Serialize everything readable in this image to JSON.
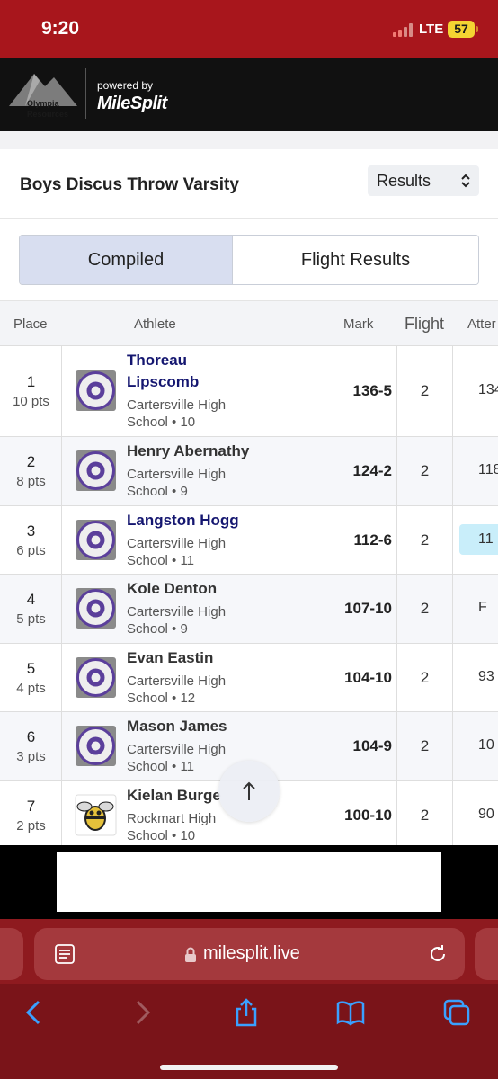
{
  "status_bar": {
    "time": "9:20",
    "network": "LTE",
    "battery": "57"
  },
  "header": {
    "org_line1": "Olympia",
    "org_line2": "Resources",
    "powered_by": "powered by",
    "brand": "MileSplit"
  },
  "event": {
    "title": "Boys Discus Throw Varsity",
    "view_select": "Results"
  },
  "tabs": {
    "compiled": "Compiled",
    "flight_results": "Flight Results"
  },
  "table": {
    "headers": {
      "place": "Place",
      "athlete": "Athlete",
      "mark": "Mark",
      "flight": "Flight",
      "attempts": "Atter"
    },
    "rows": [
      {
        "place": "1",
        "pts": "10 pts",
        "name1": "Thoreau",
        "name2": "Lipscomb",
        "school1": "Cartersville High",
        "school2": "School • 10",
        "mark": "136-5",
        "flight": "2",
        "att": "134"
      },
      {
        "place": "2",
        "pts": "8 pts",
        "name1": "Henry Abernathy",
        "school1": "Cartersville High",
        "school2": "School • 9",
        "mark": "124-2",
        "flight": "2",
        "att": "118"
      },
      {
        "place": "3",
        "pts": "6 pts",
        "name1": "Langston Hogg",
        "school1": "Cartersville High",
        "school2": "School • 11",
        "mark": "112-6",
        "flight": "2",
        "att": "11"
      },
      {
        "place": "4",
        "pts": "5 pts",
        "name1": "Kole Denton",
        "school1": "Cartersville High",
        "school2": "School • 9",
        "mark": "107-10",
        "flight": "2",
        "att": "F"
      },
      {
        "place": "5",
        "pts": "4 pts",
        "name1": "Evan Eastin",
        "school1": "Cartersville High",
        "school2": "School • 12",
        "mark": "104-10",
        "flight": "2",
        "att": "93"
      },
      {
        "place": "6",
        "pts": "3 pts",
        "name1": "Mason James",
        "school1": "Cartersville High",
        "school2": "School • 11",
        "mark": "104-9",
        "flight": "2",
        "att": "10"
      },
      {
        "place": "7",
        "pts": "2 pts",
        "name1": "Kielan Burge",
        "school1": "Rockmart High",
        "school2": "School • 10",
        "mark": "100-10",
        "flight": "2",
        "att": "90"
      }
    ]
  },
  "browser": {
    "url": "milesplit.live"
  }
}
